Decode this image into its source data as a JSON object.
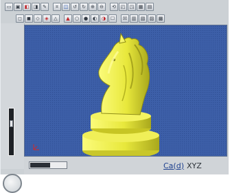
{
  "toolbar": {
    "row1": [
      {
        "glyph": "▭",
        "tone": "dark"
      },
      {
        "glyph": "▣",
        "tone": "dark"
      },
      {
        "glyph": "◧",
        "tone": "red"
      },
      {
        "glyph": "◨",
        "tone": "dark"
      },
      {
        "glyph": "✎",
        "tone": "dark"
      },
      {
        "glyph": "⌗",
        "tone": "dark"
      },
      {
        "glyph": "◫",
        "tone": "blue"
      },
      {
        "glyph": "↺",
        "tone": "dark"
      },
      {
        "glyph": "↻",
        "tone": "dark"
      },
      {
        "glyph": "⊕",
        "tone": "dark"
      },
      {
        "glyph": "⊖",
        "tone": "dark"
      },
      {
        "glyph": "⟲",
        "tone": "dark"
      },
      {
        "glyph": "◰",
        "tone": "dark"
      },
      {
        "glyph": "◳",
        "tone": "dark"
      },
      {
        "glyph": "▦",
        "tone": "dark"
      },
      {
        "glyph": "▤",
        "tone": "dark"
      }
    ],
    "row2": [
      {
        "glyph": "◻",
        "tone": "dark"
      },
      {
        "glyph": "◼",
        "tone": "dark"
      },
      {
        "glyph": "◇",
        "tone": "dark"
      },
      {
        "glyph": "◈",
        "tone": "red"
      },
      {
        "glyph": "△",
        "tone": "dark"
      },
      {
        "glyph": "▲",
        "tone": "red"
      },
      {
        "glyph": "○",
        "tone": "dark"
      },
      {
        "glyph": "●",
        "tone": "dark"
      },
      {
        "glyph": "◐",
        "tone": "dark"
      },
      {
        "glyph": "◑",
        "tone": "red"
      },
      {
        "glyph": "☐",
        "tone": "dark"
      },
      {
        "glyph": "☒",
        "tone": "dark"
      },
      {
        "glyph": "▥",
        "tone": "dark"
      },
      {
        "glyph": "▧",
        "tone": "dark"
      },
      {
        "glyph": "▨",
        "tone": "dark"
      },
      {
        "glyph": "▩",
        "tone": "dark"
      }
    ]
  },
  "left_panel": {
    "zoom_slider_level": 0.7
  },
  "viewport": {
    "object": "chess-knight",
    "background_color": "#3d5fa8",
    "model_color": "#eaea3a"
  },
  "status_bar": {
    "progress": 0.55,
    "coord_value": "Ca(d)",
    "coord_readout": "XYZ"
  }
}
